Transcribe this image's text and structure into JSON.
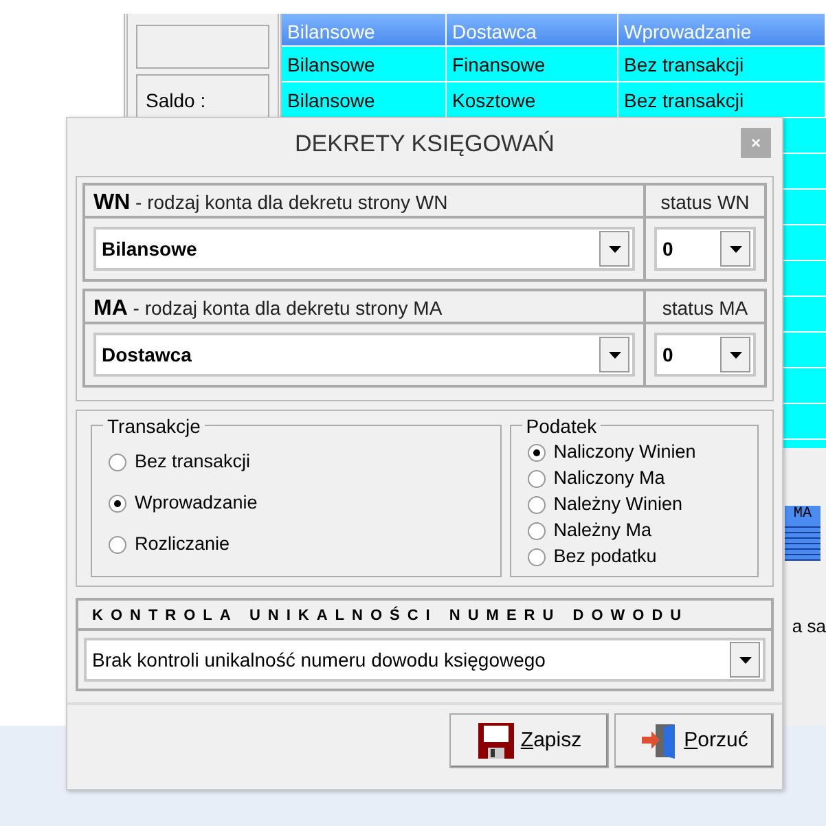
{
  "background": {
    "saldo_label": "Saldo :",
    "grid": {
      "header": [
        "Bilansowe",
        "Dostawca",
        "Wprowadzanie"
      ],
      "rows": [
        [
          "Bilansowe",
          "Finansowe",
          "Bez transakcji"
        ],
        [
          "Bilansowe",
          "Kosztowe",
          "Bez transakcji"
        ]
      ]
    },
    "tile_label": "MA",
    "partial_text": "a sa"
  },
  "dialog": {
    "title": "DEKRETY KSIĘGOWAŃ",
    "close": "×",
    "sides": [
      {
        "code": "WN",
        "caption": " - rodzaj konta dla dekretu strony  WN",
        "status_label": "status WN",
        "account": "Bilansowe",
        "status": "0"
      },
      {
        "code": "MA",
        "caption": " - rodzaj konta dla dekretu strony  MA",
        "status_label": "status MA",
        "account": "Dostawca",
        "status": "0"
      }
    ],
    "transakcje": {
      "legend": "Transakcje",
      "options": [
        {
          "label": "Bez transakcji",
          "selected": false
        },
        {
          "label": "Wprowadzanie",
          "selected": true
        },
        {
          "label": "Rozliczanie",
          "selected": false
        }
      ]
    },
    "podatek": {
      "legend": "Podatek",
      "options": [
        {
          "label": "Naliczony Winien",
          "selected": true
        },
        {
          "label": "Naliczony Ma",
          "selected": false
        },
        {
          "label": "Należny Winien",
          "selected": false
        },
        {
          "label": "Należny Ma",
          "selected": false
        },
        {
          "label": "Bez podatku",
          "selected": false
        }
      ]
    },
    "kontrola": {
      "title": "KONTROLA UNIKALNOŚCI NUMERU DOWODU",
      "value": "Brak kontroli unikalność numeru dowodu księgowego"
    },
    "buttons": [
      {
        "kind": "save",
        "mnemonic": "Z",
        "rest": "apisz"
      },
      {
        "kind": "cancel",
        "mnemonic": "P",
        "rest": "orzuć"
      }
    ]
  }
}
